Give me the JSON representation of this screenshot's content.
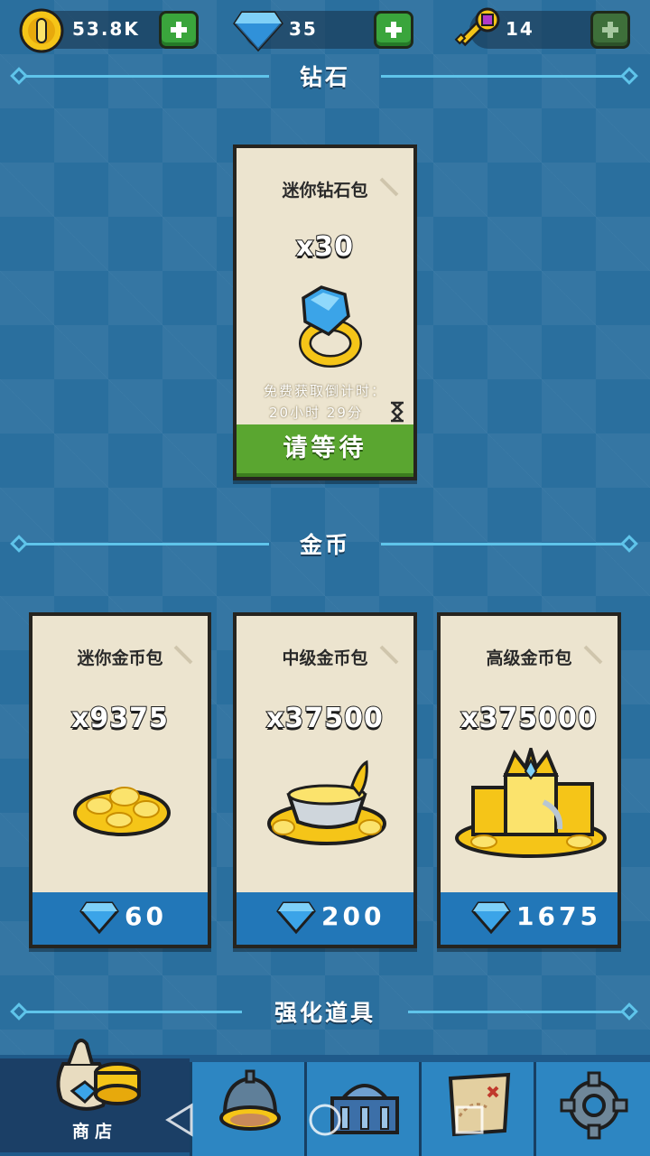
{
  "resources": {
    "gold": {
      "value": "53.8K",
      "icon": "gold-coin-icon"
    },
    "gems": {
      "value": "35",
      "icon": "diamond-icon"
    },
    "keys": {
      "value": "14",
      "icon": "key-icon"
    }
  },
  "sections": {
    "diamonds": {
      "title": "钻石"
    },
    "gold": {
      "title": "金币"
    },
    "boosts": {
      "title": "强化道具"
    }
  },
  "diamond_offer": {
    "title": "迷你钻石包",
    "amount": "x30",
    "timer_label": "免费获取倒计时：",
    "timer_value": "20小时 29分",
    "button_label": "请等待"
  },
  "gold_offers": [
    {
      "title": "迷你金币包",
      "amount": "x9375",
      "price": "60"
    },
    {
      "title": "中级金币包",
      "amount": "x37500",
      "price": "200"
    },
    {
      "title": "高级金币包",
      "amount": "x375000",
      "price": "1675"
    }
  ],
  "nav": {
    "tabs": [
      {
        "label": "商店",
        "icon": "shop-bag-icon",
        "active": true
      },
      {
        "label": "",
        "icon": "helmet-icon"
      },
      {
        "label": "",
        "icon": "castle-icon"
      },
      {
        "label": "",
        "icon": "map-icon"
      },
      {
        "label": "",
        "icon": "gear-icon"
      }
    ]
  },
  "colors": {
    "background": "#2a6f9e",
    "accent_line": "#5fc4ea",
    "card": "#ece4cf",
    "price_bar": "#2277b8",
    "wait_button": "#5aa630",
    "plus_button": "#3aa53c"
  }
}
